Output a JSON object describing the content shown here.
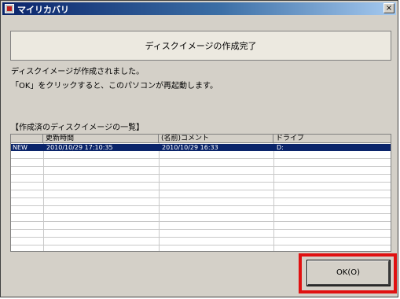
{
  "window": {
    "title": "マイリカバリ",
    "close_glyph": "×"
  },
  "banner": {
    "text": "ディスクイメージの作成完了"
  },
  "messages": [
    "ディスクイメージが作成されました。",
    "「OK」をクリックすると、このパソコンが再起動します。"
  ],
  "list": {
    "title": "【作成済のディスクイメージの一覧】",
    "columns": [
      "",
      "更新時間",
      "(名前)コメント",
      "ドライブ"
    ],
    "rows": [
      {
        "status": "NEW",
        "updated": "2010/10/29 17:10:35",
        "comment": "2010/10/29 16:33",
        "drive": "D:"
      }
    ]
  },
  "buttons": {
    "ok_label": "OK(O)"
  },
  "colors": {
    "selection": "#0a246a",
    "highlight": "#e01010",
    "dialog_bg": "#d4d0c8"
  }
}
